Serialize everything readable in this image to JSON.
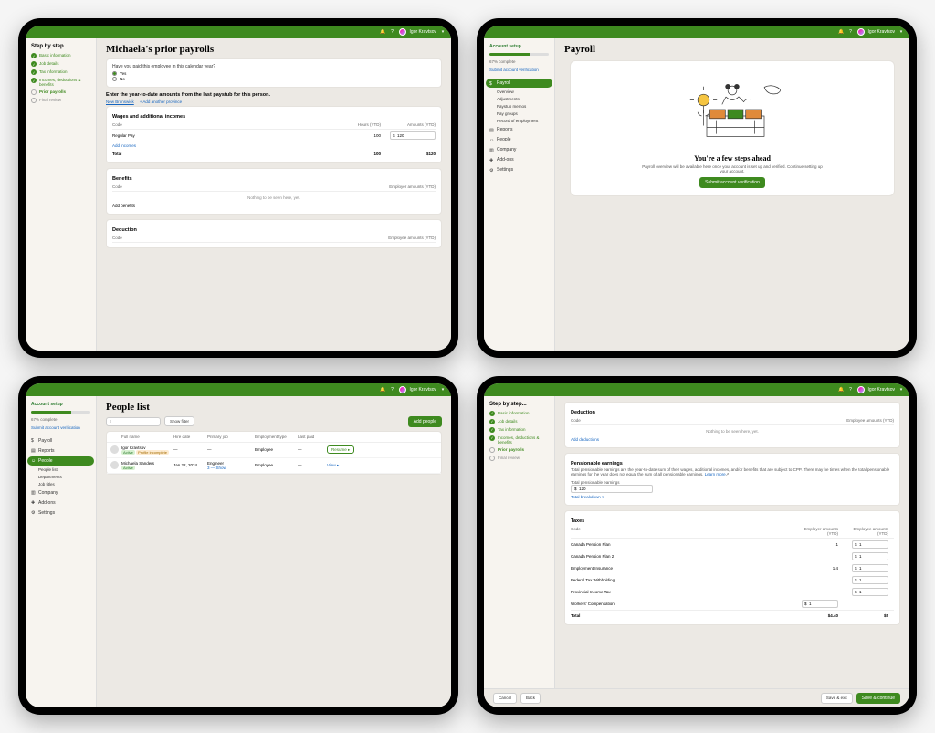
{
  "user": {
    "name": "Igor Kravtsov"
  },
  "screen1": {
    "stepper": {
      "title": "Step by step...",
      "steps": [
        {
          "label": "Basic information",
          "state": "done"
        },
        {
          "label": "Job details",
          "state": "done"
        },
        {
          "label": "Tax information",
          "state": "done"
        },
        {
          "label": "Incomes, deductions & benefits",
          "state": "done"
        },
        {
          "label": "Prior payrolls",
          "state": "current"
        },
        {
          "label": "Final review",
          "state": "todo"
        }
      ]
    },
    "title": "Michaela's prior payrolls",
    "question": "Have you paid this employee in this calendar year?",
    "opt_yes": "Yes",
    "opt_no": "No",
    "lead": "Enter the year-to-date amounts from the last paystub for this person.",
    "province": "New Brunswick",
    "add_prov": "+ Add another province",
    "wages_head": "Wages and additional incomes",
    "wages_cols": {
      "code": "Code",
      "hours": "Hours (YTD)",
      "amounts": "Amounts (YTD)"
    },
    "wages_rows": [
      {
        "code": "Regular Pay",
        "hours": "100",
        "amount": "$  120"
      }
    ],
    "add_income": "Add incomes",
    "total_label": "Total",
    "total_hours": "100",
    "total_amount": "$120",
    "benefits_head": "Benefits",
    "benefits_cols": {
      "code": "Code",
      "amt": "Employer amounts (YTD)"
    },
    "benefits_empty": "Nothing to be seen here, yet.",
    "add_benefits": "Add benefits",
    "deduction_head": "Deduction",
    "deduction_cols": {
      "code": "Code",
      "amt": "Employee amounts (YTD)"
    }
  },
  "screen2": {
    "setup": {
      "title": "Account setup",
      "pct": "67% complete",
      "link": "Submit account verification"
    },
    "nav": {
      "payroll": "Payroll",
      "sub": [
        "Overview",
        "Adjustments",
        "Paystub memos",
        "Pay groups",
        "Record of employment"
      ],
      "reports": "Reports",
      "people": "People",
      "company": "Company",
      "addons": "Add-ons",
      "settings": "Settings"
    },
    "title": "Payroll",
    "hero": {
      "title": "You're a few steps ahead",
      "desc": "Payroll overview will be available here once your account is set up and verified. Continue setting up your account.",
      "cta": "Submit account verification"
    }
  },
  "screen3": {
    "setup": {
      "title": "Account setup",
      "pct": "67% complete",
      "link": "Submit account verification"
    },
    "nav": {
      "payroll": "Payroll",
      "reports": "Reports",
      "people": "People",
      "people_sub": [
        "People list",
        "Departments",
        "Job titles"
      ],
      "company": "Company",
      "addons": "Add-ons",
      "settings": "Settings"
    },
    "title": "People list",
    "show_filter": "Show filter",
    "add_people": "Add people",
    "cols": {
      "name": "Full name",
      "hire": "Hire date",
      "primary": "Primary job",
      "etype": "Employment type",
      "last": "Last paid"
    },
    "rows": [
      {
        "name": "Igor Kravtsov",
        "badges": [
          "Active",
          "Profile incomplete"
        ],
        "hire": "—",
        "primary": "—",
        "etype": "Employee",
        "last": "—",
        "action": "Resume"
      },
      {
        "name": "Michaela Sanders",
        "badges": [
          "Active"
        ],
        "hire": "Jan 22, 2024",
        "primary": "Engineer",
        "primary_more": "3 — Show",
        "etype": "Employee",
        "last": "—",
        "action": "View"
      }
    ]
  },
  "screen4": {
    "stepper": {
      "title": "Step by step...",
      "steps": [
        {
          "label": "Basic information",
          "state": "done"
        },
        {
          "label": "Job details",
          "state": "done"
        },
        {
          "label": "Tax information",
          "state": "done"
        },
        {
          "label": "Incomes, deductions & benefits",
          "state": "done"
        },
        {
          "label": "Prior payrolls",
          "state": "current"
        },
        {
          "label": "Final review",
          "state": "todo"
        }
      ]
    },
    "deduction": {
      "head": "Deduction",
      "cols": {
        "code": "Code",
        "amt": "Employee amounts (YTD)"
      },
      "empty": "Nothing to be seen here, yet.",
      "add": "Add deductions"
    },
    "pe": {
      "head": "Pensionable earnings",
      "desc": "Total pensionable earnings are the year-to-date sum of their wages, additional incomes, and/or benefits that are subject to CPP. There may be times when the total pensionable earnings for the year does not equal the sum of all pensionable earnings.",
      "learn": "Learn more",
      "label": "Total pensionable earnings",
      "value": "$  120",
      "breakdown": "Total breakdown"
    },
    "taxes": {
      "head": "Taxes",
      "cols": {
        "code": "Code",
        "er": "Employer amounts (YTD)",
        "ee": "Employee amounts (YTD)"
      },
      "rows": [
        {
          "code": "Canada Pension Plan",
          "er": "1",
          "ee": "$  1"
        },
        {
          "code": "Canada Pension Plan 2",
          "er": "",
          "ee": "$  1"
        },
        {
          "code": "Employment Insurance",
          "er": "1.4",
          "ee": "$  1"
        },
        {
          "code": "Federal Tax Withholding",
          "er": "",
          "ee": "$  1"
        },
        {
          "code": "Provincial Income Tax",
          "er": "",
          "ee": "$  1"
        },
        {
          "code": "Workers' Compensation",
          "er_input": "$  1",
          "ee": ""
        }
      ],
      "total_label": "Total",
      "total_er": "$4.40",
      "total_ee": "$5"
    },
    "footer": {
      "cancel": "Cancel",
      "back": "Back",
      "save_exit": "Save & exit",
      "save_cont": "Save & continue"
    }
  }
}
